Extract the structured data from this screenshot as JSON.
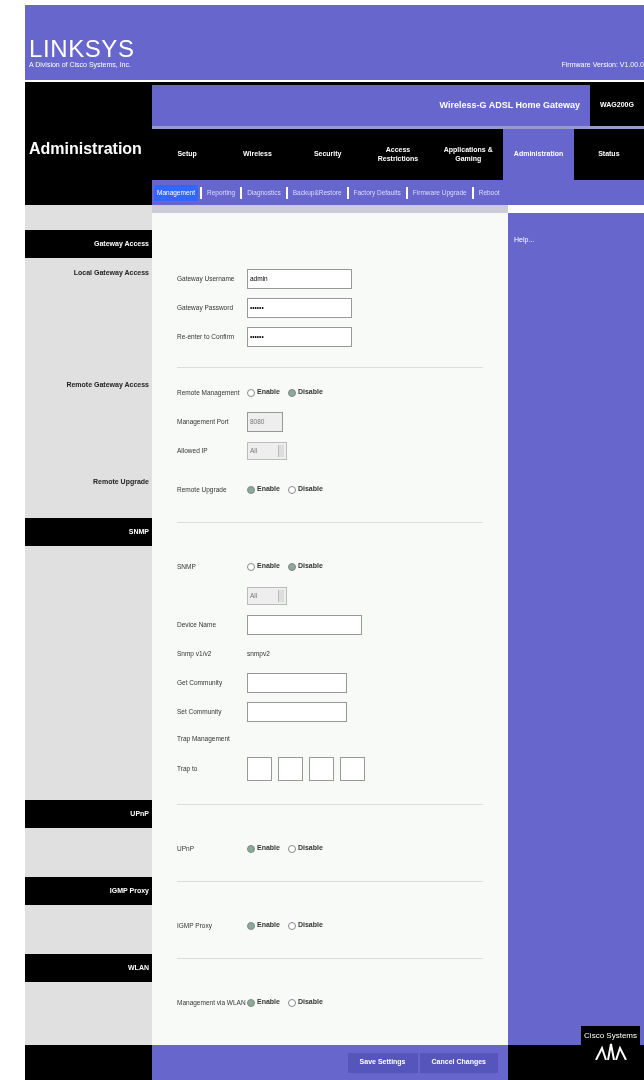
{
  "header": {
    "logo": "LINKSYS",
    "tagline": "A Division of Cisco Systems, Inc.",
    "firmware": "Firmware Version: V1.00.0"
  },
  "product": {
    "name": "Wireless-G ADSL Home Gateway",
    "model": "WAG200G"
  },
  "page_title": "Administration",
  "tabs": [
    {
      "label": "Setup",
      "selected": false
    },
    {
      "label": "Wireless",
      "selected": false
    },
    {
      "label": "Security",
      "selected": false
    },
    {
      "label": "Access Restrictions",
      "selected": false
    },
    {
      "label": "Applications & Gaming",
      "selected": false
    },
    {
      "label": "Administration",
      "selected": true
    },
    {
      "label": "Status",
      "selected": false
    }
  ],
  "subtabs": [
    {
      "label": "Management",
      "selected": true
    },
    {
      "label": "Reporting",
      "selected": false
    },
    {
      "label": "Diagnostics",
      "selected": false
    },
    {
      "label": "Backup&Restore",
      "selected": false
    },
    {
      "label": "Factory Defaults",
      "selected": false
    },
    {
      "label": "Firmware Upgrade",
      "selected": false
    },
    {
      "label": "Reboot",
      "selected": false
    }
  ],
  "sections": [
    {
      "heading": "Gateway Access",
      "groups": [
        {
          "label": "Local Gateway Access",
          "fields": [
            {
              "kind": "text",
              "label": "Gateway Username",
              "value": "admin"
            },
            {
              "kind": "text",
              "label": "Gateway Password",
              "value": "••••••"
            },
            {
              "kind": "text",
              "label": "Re-enter to Confirm",
              "value": "••••••"
            }
          ]
        },
        {
          "label": "Remote Gateway Access",
          "fields": [
            {
              "kind": "radio",
              "label": "Remote Management",
              "options": [
                {
                  "label": "Enable",
                  "selected": false
                },
                {
                  "label": "Disable",
                  "selected": true
                }
              ]
            },
            {
              "kind": "port",
              "label": "Management Port",
              "value": "8080",
              "disabled": true
            },
            {
              "kind": "select",
              "label": "Allowed IP",
              "value": "All",
              "disabled": true
            }
          ]
        },
        {
          "label": "Remote Upgrade",
          "fields": [
            {
              "kind": "radio",
              "label": "Remote Upgrade",
              "options": [
                {
                  "label": "Enable",
                  "selected": true
                },
                {
                  "label": "Disable",
                  "selected": false
                }
              ]
            }
          ]
        }
      ]
    },
    {
      "heading": "SNMP",
      "groups": [
        {
          "fields": [
            {
              "kind": "radio",
              "label": "SNMP",
              "options": [
                {
                  "label": "Enable",
                  "selected": false
                },
                {
                  "label": "Disable",
                  "selected": true
                }
              ]
            },
            {
              "kind": "select",
              "value": "All",
              "disabled": true
            },
            {
              "kind": "wide",
              "label": "Device Name"
            },
            {
              "kind": "static",
              "label": "Snmp v1/v2",
              "value": "snmpv2"
            },
            {
              "kind": "mid",
              "label": "Get Community"
            },
            {
              "kind": "mid",
              "label": "Set Community"
            },
            {
              "kind": "note",
              "label": "Trap Management"
            },
            {
              "kind": "ip",
              "label": "Trap to"
            }
          ]
        }
      ]
    },
    {
      "heading": "UPnP",
      "groups": [
        {
          "fields": [
            {
              "kind": "radio",
              "label": "UPnP",
              "options": [
                {
                  "label": "Enable",
                  "selected": true
                },
                {
                  "label": "Disable",
                  "selected": false
                }
              ]
            }
          ]
        }
      ]
    },
    {
      "heading": "IGMP Proxy",
      "groups": [
        {
          "fields": [
            {
              "kind": "radio",
              "label": "IGMP Proxy",
              "options": [
                {
                  "label": "Enable",
                  "selected": true
                },
                {
                  "label": "Disable",
                  "selected": false
                }
              ]
            }
          ]
        }
      ]
    },
    {
      "heading": "WLAN",
      "groups": [
        {
          "fields": [
            {
              "kind": "radio",
              "label": "Management via WLAN",
              "options": [
                {
                  "label": "Enable",
                  "selected": true
                },
                {
                  "label": "Disable",
                  "selected": false
                }
              ]
            }
          ]
        }
      ]
    }
  ],
  "help": "Help...",
  "buttons": [
    "Save Settings",
    "Cancel Changes"
  ],
  "footer_logo": "Cisco Systems"
}
